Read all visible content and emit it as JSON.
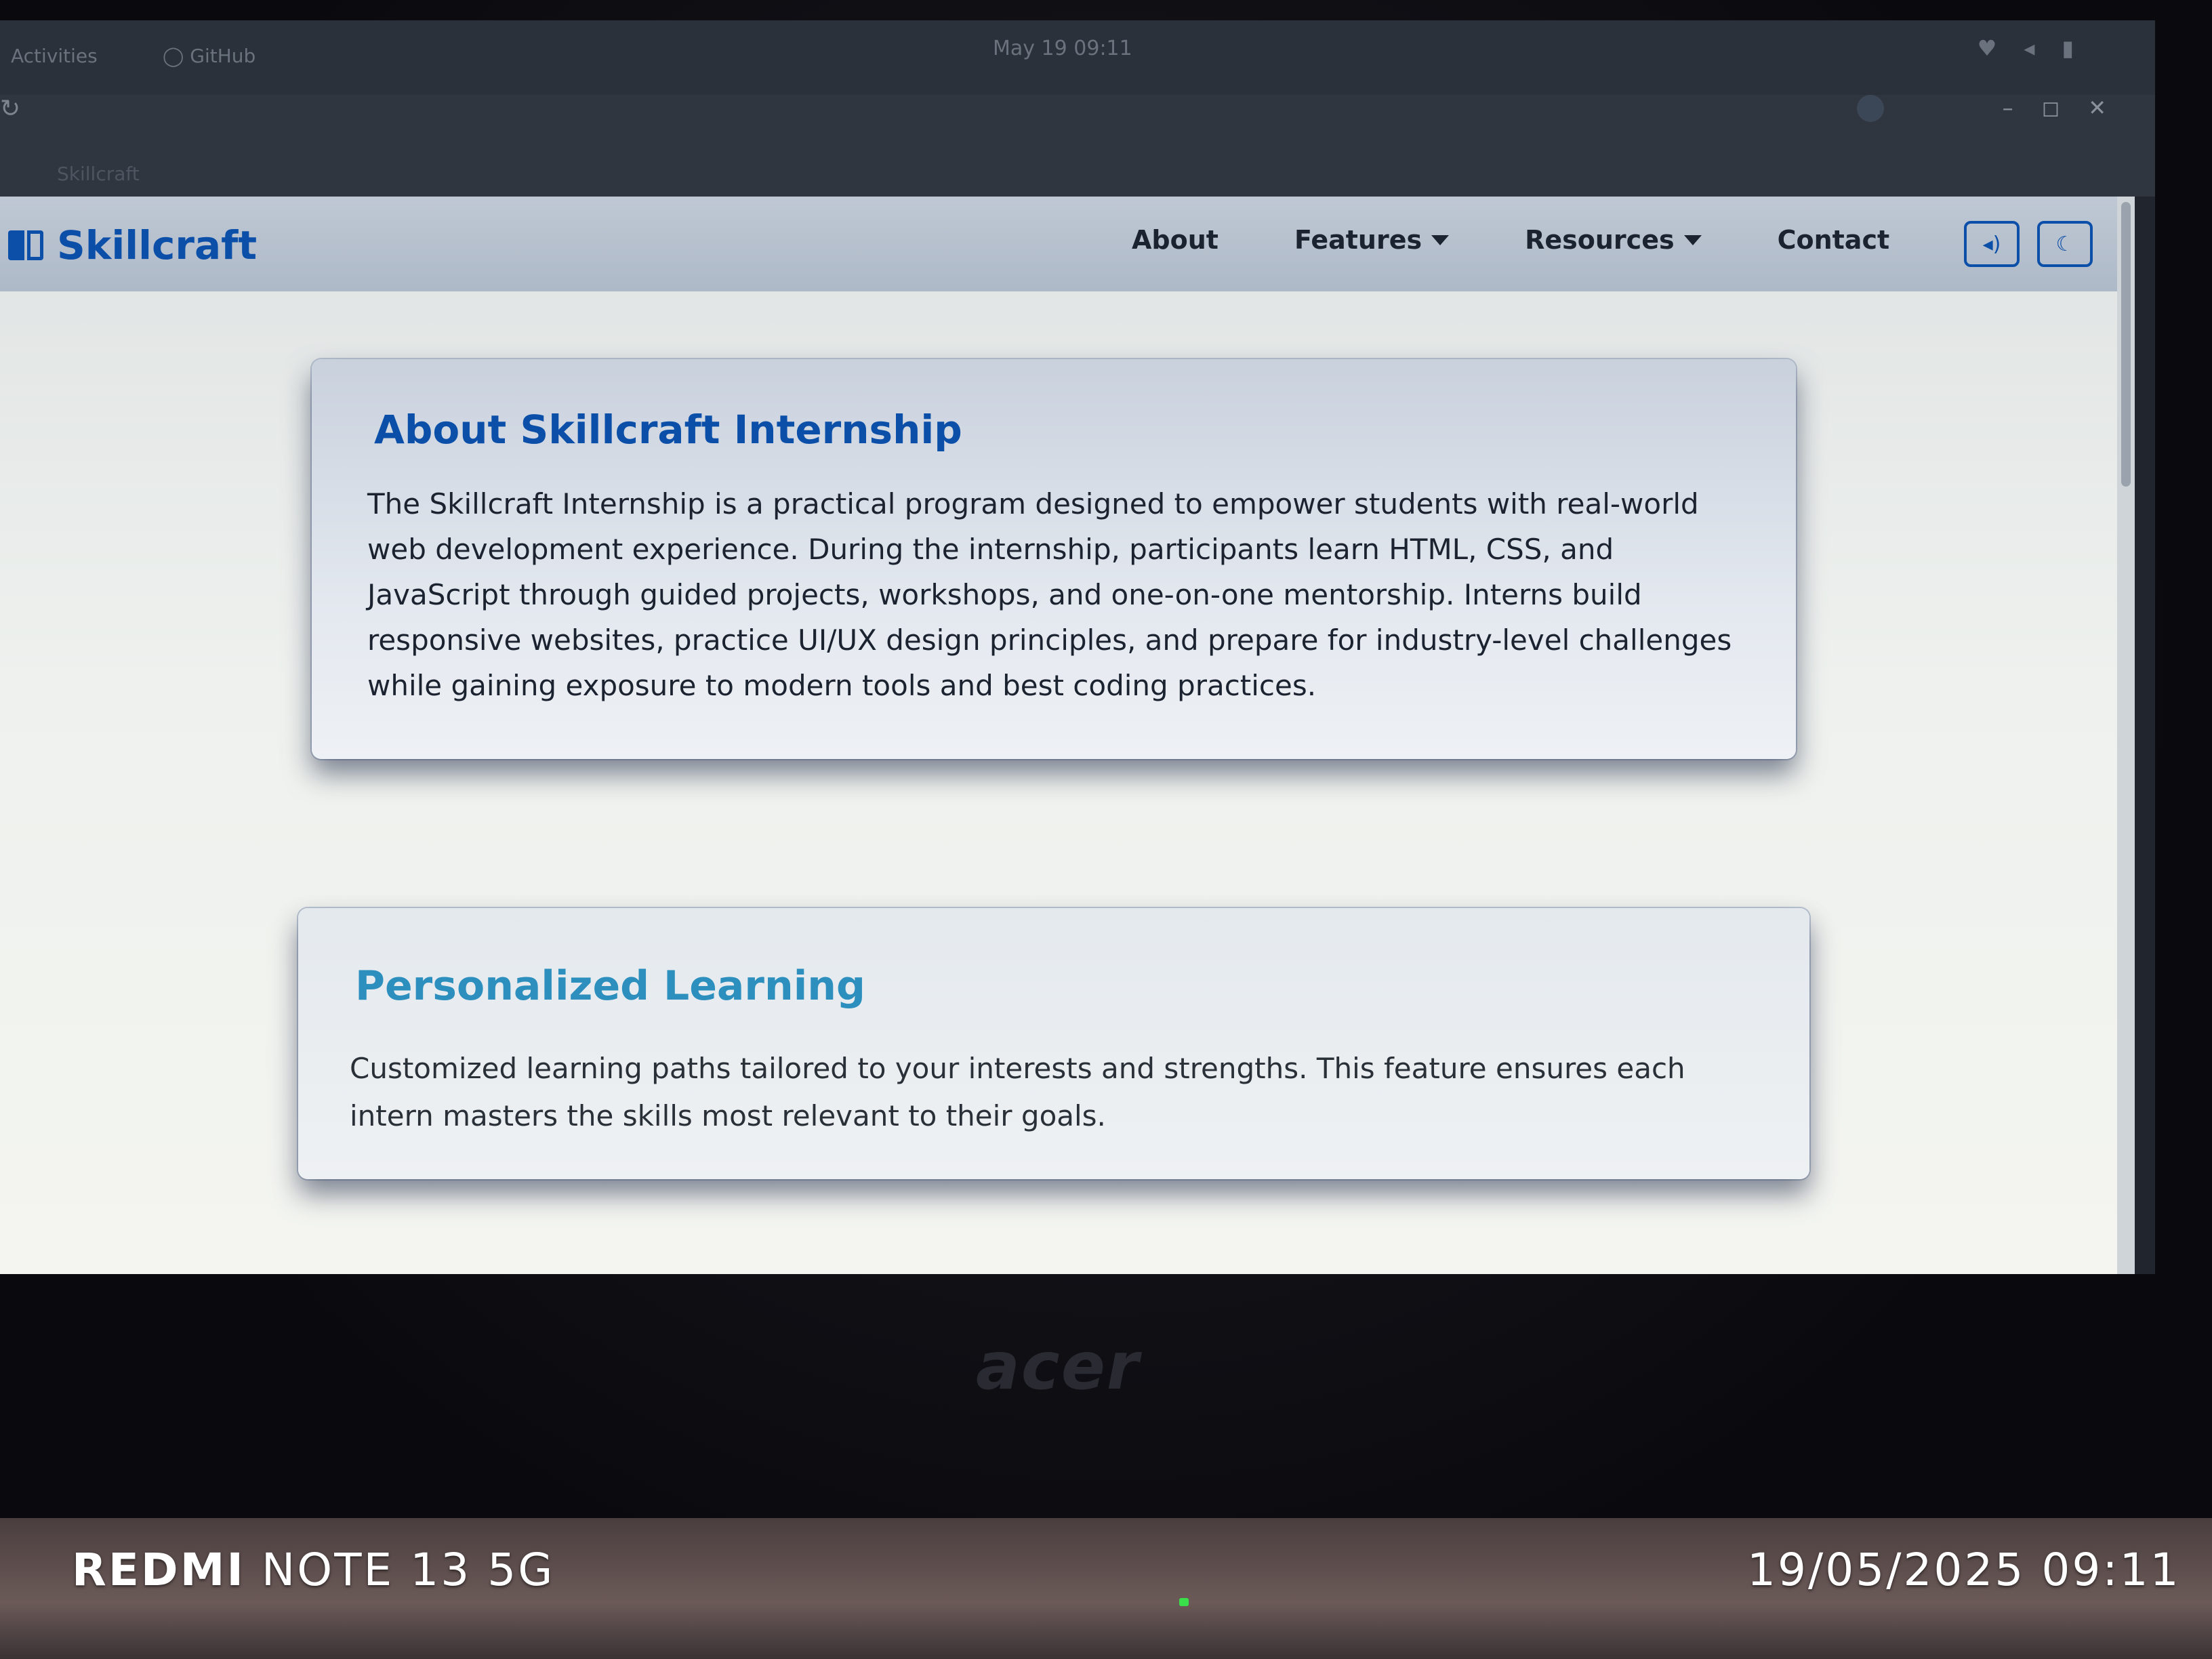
{
  "os_bar": {
    "activities": "Activities",
    "app": "GitHub",
    "clock": "May 19  09:11"
  },
  "browser": {
    "tab_title": "Skillcraft"
  },
  "site": {
    "brand": "Skillcraft",
    "nav": {
      "about": "About",
      "features": "Features",
      "resources": "Resources",
      "contact": "Contact"
    },
    "buttons": {
      "sound_icon": "speaker-icon",
      "theme_icon": "moon-icon"
    }
  },
  "about_card": {
    "title": "About Skillcraft Internship",
    "body": "The Skillcraft Internship is a practical program designed to empower students with real-world web development experience. During the internship, participants learn HTML, CSS, and JavaScript through guided projects, workshops, and one-on-one mentorship. Interns build responsive websites, practice UI/UX design principles, and prepare for industry-level challenges while gaining exposure to modern tools and best coding practices."
  },
  "learning_card": {
    "title": "Personalized Learning",
    "body": "Customized learning paths tailored to your interests and strengths. This feature ensures each intern masters the skills most relevant to their goals."
  },
  "laptop": {
    "logo": "acer"
  },
  "watermark": {
    "brand": "REDMI",
    "model": "NOTE 13 5G",
    "timestamp": "19/05/2025 09:11"
  },
  "colors": {
    "brand_blue": "#0b4fa8",
    "accent_teal": "#2c8fbd",
    "navbar_bg": "#b6c0ce"
  }
}
